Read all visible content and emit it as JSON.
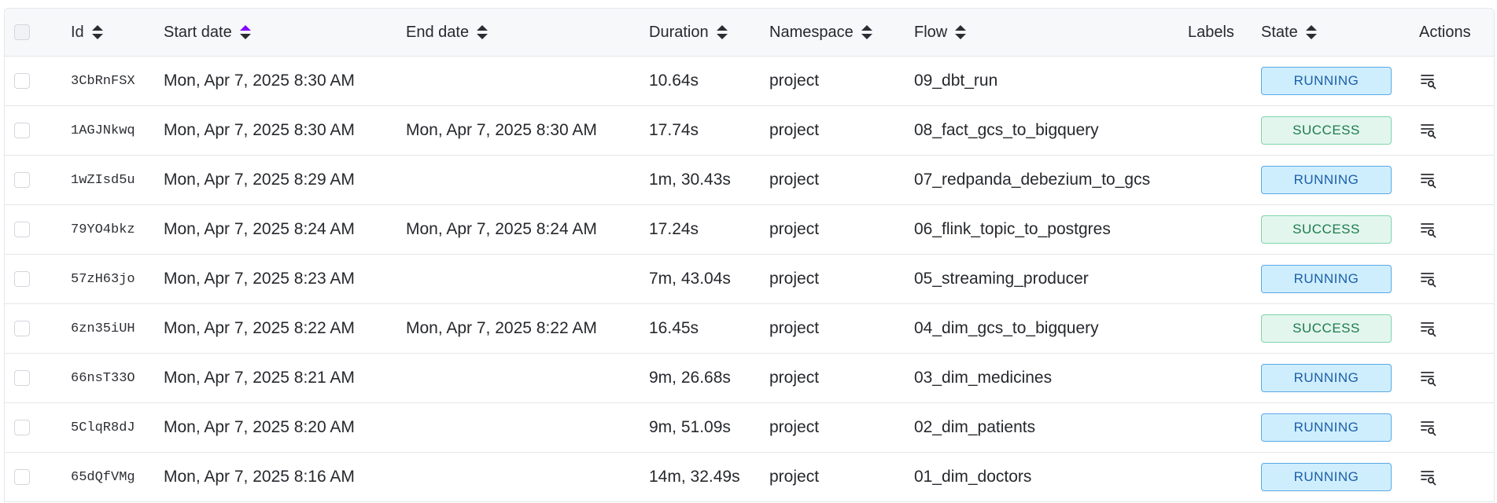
{
  "header": {
    "id": "Id",
    "start_date": "Start date",
    "end_date": "End date",
    "duration": "Duration",
    "namespace": "Namespace",
    "flow": "Flow",
    "labels": "Labels",
    "state": "State",
    "actions": "Actions"
  },
  "colors": {
    "accent": "#8405ff",
    "running_bg": "#cfeefd",
    "running_border": "#5aa8e6",
    "success_bg": "#e3f6ee",
    "success_border": "#7fd4a9"
  },
  "rows": [
    {
      "id": "3CbRnFSX",
      "start": "Mon, Apr 7, 2025 8:30 AM",
      "end": "",
      "duration": "10.64s",
      "namespace": "project",
      "flow": "09_dbt_run",
      "state": "RUNNING"
    },
    {
      "id": "1AGJNkwq",
      "start": "Mon, Apr 7, 2025 8:30 AM",
      "end": "Mon, Apr 7, 2025 8:30 AM",
      "duration": "17.74s",
      "namespace": "project",
      "flow": "08_fact_gcs_to_bigquery",
      "state": "SUCCESS"
    },
    {
      "id": "1wZIsd5u",
      "start": "Mon, Apr 7, 2025 8:29 AM",
      "end": "",
      "duration": "1m, 30.43s",
      "namespace": "project",
      "flow": "07_redpanda_debezium_to_gcs",
      "state": "RUNNING"
    },
    {
      "id": "79YO4bkz",
      "start": "Mon, Apr 7, 2025 8:24 AM",
      "end": "Mon, Apr 7, 2025 8:24 AM",
      "duration": "17.24s",
      "namespace": "project",
      "flow": "06_flink_topic_to_postgres",
      "state": "SUCCESS"
    },
    {
      "id": "57zH63jo",
      "start": "Mon, Apr 7, 2025 8:23 AM",
      "end": "",
      "duration": "7m, 43.04s",
      "namespace": "project",
      "flow": "05_streaming_producer",
      "state": "RUNNING"
    },
    {
      "id": "6zn35iUH",
      "start": "Mon, Apr 7, 2025 8:22 AM",
      "end": "Mon, Apr 7, 2025 8:22 AM",
      "duration": "16.45s",
      "namespace": "project",
      "flow": "04_dim_gcs_to_bigquery",
      "state": "SUCCESS"
    },
    {
      "id": "66nsT33O",
      "start": "Mon, Apr 7, 2025 8:21 AM",
      "end": "",
      "duration": "9m, 26.68s",
      "namespace": "project",
      "flow": "03_dim_medicines",
      "state": "RUNNING"
    },
    {
      "id": "5ClqR8dJ",
      "start": "Mon, Apr 7, 2025 8:20 AM",
      "end": "",
      "duration": "9m, 51.09s",
      "namespace": "project",
      "flow": "02_dim_patients",
      "state": "RUNNING"
    },
    {
      "id": "65dQfVMg",
      "start": "Mon, Apr 7, 2025 8:16 AM",
      "end": "",
      "duration": "14m, 32.49s",
      "namespace": "project",
      "flow": "01_dim_doctors",
      "state": "RUNNING"
    }
  ]
}
